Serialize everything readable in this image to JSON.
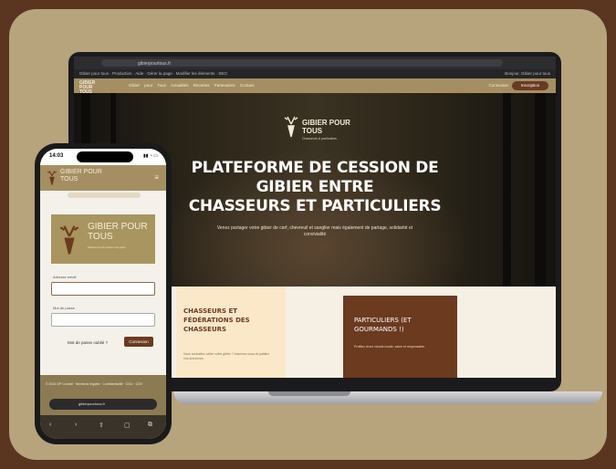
{
  "laptop": {
    "browser": {
      "url": "gibierpourtous.fr",
      "bookmarks": "Gibier pour tous  ·  Production  ·  Aide  ·  Gérer la page  ·  Modifier les éléments  ·  SEO",
      "bookmarks_right": "Bonjour, Gibier pour tous"
    },
    "nav": {
      "logo": "GIBIER POUR TOUS",
      "links": "Gibier pour Tous   Actualités   Recettes   Partenaires   Contact",
      "login": "Connexion",
      "cta": "Inscription"
    },
    "hero": {
      "logo_text": "GIBIER POUR TOUS",
      "logo_sub": "Chasseurs & particuliers",
      "title_line1": "PLATEFORME DE CESSION DE",
      "title_line2": "GIBIER ENTRE",
      "title_line3": "CHASSEURS ET PARTICULIERS",
      "subtitle": "Venez partager votre gibier de cerf, chevreuil et sanglier mais également de partage, solidarité et convivialité"
    },
    "cards": {
      "left_title": "CHASSEURS ET FÉDÉRATIONS DES CHASSEURS",
      "left_body": "Vous souhaitez céder votre gibier ? Inscrivez-vous et publiez vos annonces.",
      "right_title": "PARTICULIERS (ET GOURMANDS !)",
      "right_body": "Profitez d'une viande locale, saine et responsable."
    }
  },
  "phone": {
    "time": "14:03",
    "status_icons": "▮▮ ◔ ▭",
    "nav_logo": "GIBIER POUR TOUS",
    "menu_icon": "≡",
    "card_title": "GIBIER POUR TOUS",
    "card_sub": "Plateforme de cession de gibier",
    "email_label": "Adresse email",
    "password_label": "Mot de passe",
    "forgot": "Mot de passe oublié ?",
    "connect": "Connexion",
    "footer_text": "© 2024 GP Conseil · Mentions légales · Confidentialité · CGU · CGV",
    "url": "gibierpourtous.fr",
    "tabs": [
      "‹",
      "›",
      "⇧",
      "▢",
      "⧉"
    ]
  }
}
